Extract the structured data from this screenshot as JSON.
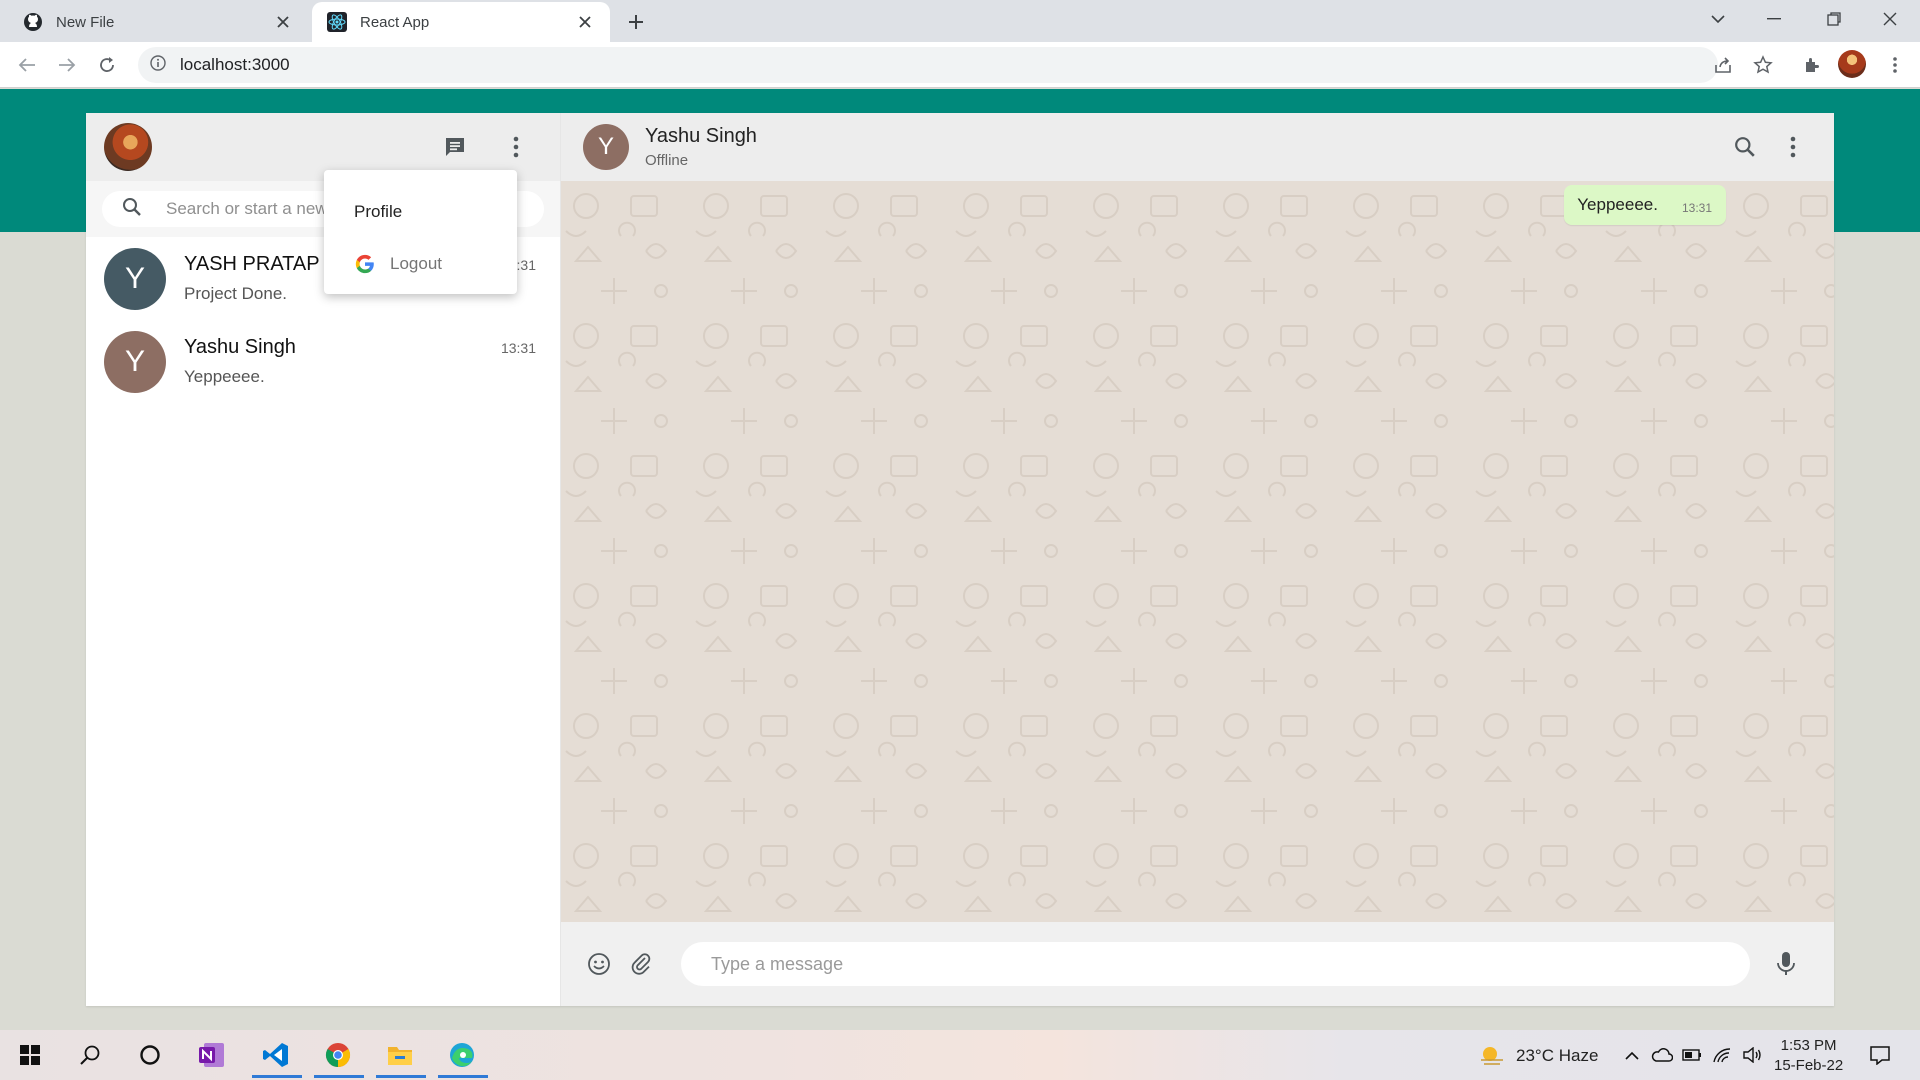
{
  "browser": {
    "tabs": [
      {
        "title": "New File",
        "active": false,
        "icon": "github-icon"
      },
      {
        "title": "React App",
        "active": true,
        "icon": "react-icon"
      }
    ],
    "url": "localhost:3000"
  },
  "sidebar": {
    "search_placeholder": "Search or start a new chat",
    "menu": {
      "profile_label": "Profile",
      "logout_label": "Logout"
    },
    "chats": [
      {
        "initial": "Y",
        "name": "YASH PRATAP",
        "last": "Project Done.",
        "time": "13:31",
        "color": "#455a64"
      },
      {
        "initial": "Y",
        "name": "Yashu Singh",
        "last": "Yeppeeee.",
        "time": "13:31",
        "color": "#8d6e63"
      }
    ]
  },
  "chat": {
    "header": {
      "initial": "Y",
      "name": "Yashu Singh",
      "status": "Offline"
    },
    "messages": [
      {
        "text": "Yeppeeee.",
        "time": "13:31",
        "sent": true
      }
    ],
    "composer_placeholder": "Type a message"
  },
  "taskbar": {
    "weather": "23°C  Haze",
    "time": "1:53 PM",
    "date": "15-Feb-22"
  },
  "colors": {
    "teal": "#00897b",
    "chat_bg": "#e5ddd5",
    "bubble_sent": "#dcf8c6"
  }
}
